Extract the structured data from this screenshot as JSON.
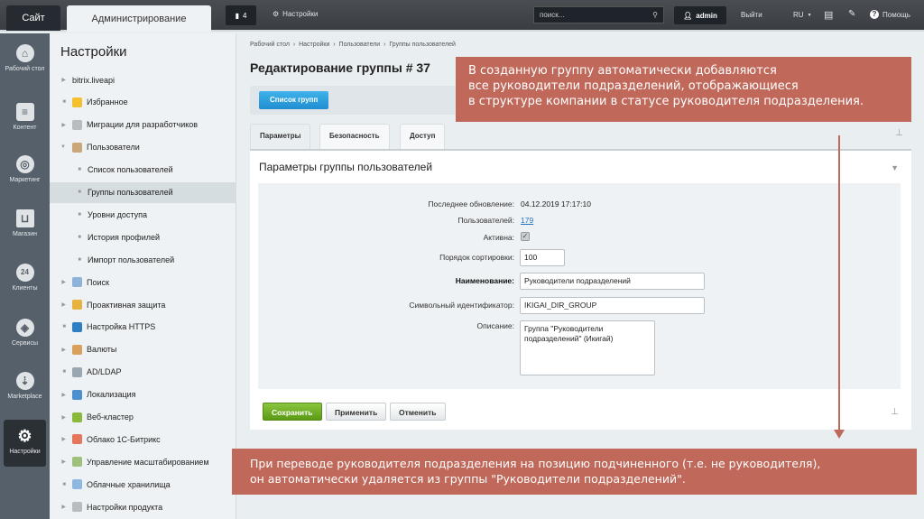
{
  "topbar": {
    "site": "Сайт",
    "admin": "Администрирование",
    "notifications": "4",
    "settings": "Настройки",
    "search_placeholder": "поиск...",
    "user": "admin",
    "logout": "Выйти",
    "lang": "RU",
    "help": "Помощь"
  },
  "iconbar": [
    {
      "label": "Рабочий стол",
      "icon": "home-icon"
    },
    {
      "label": "Контент",
      "icon": "document-icon"
    },
    {
      "label": "Маркетинг",
      "icon": "target-icon"
    },
    {
      "label": "Магазин",
      "icon": "basket-icon"
    },
    {
      "label": "Клиенты",
      "icon": "24-icon"
    },
    {
      "label": "Сервисы",
      "icon": "layers-icon"
    },
    {
      "label": "Marketplace",
      "icon": "cloud-download-icon"
    },
    {
      "label": "Настройки",
      "icon": "gear-icon"
    }
  ],
  "menu": {
    "title": "Настройки",
    "items": [
      {
        "label": "bitrix.liveapi"
      },
      {
        "label": "Избранное"
      },
      {
        "label": "Миграции для разработчиков"
      },
      {
        "label": "Пользователи"
      },
      {
        "label": "Список пользователей"
      },
      {
        "label": "Группы пользователей"
      },
      {
        "label": "Уровни доступа"
      },
      {
        "label": "История профилей"
      },
      {
        "label": "Импорт пользователей"
      },
      {
        "label": "Поиск"
      },
      {
        "label": "Проактивная защита"
      },
      {
        "label": "Настройка HTTPS"
      },
      {
        "label": "Валюты"
      },
      {
        "label": "AD/LDAP"
      },
      {
        "label": "Локализация"
      },
      {
        "label": "Веб-кластер"
      },
      {
        "label": "Облако 1С-Битрикс"
      },
      {
        "label": "Управление масштабированием"
      },
      {
        "label": "Облачные хранилища"
      },
      {
        "label": "Настройки продукта"
      }
    ]
  },
  "breadcrumbs": [
    "Рабочий стол",
    "Настройки",
    "Пользователи",
    "Группы пользователей"
  ],
  "page_title": "Редактирование группы # 37",
  "list_button": "Список групп",
  "tabs": [
    "Параметры",
    "Безопасность",
    "Доступ"
  ],
  "panel_title": "Параметры группы пользователей",
  "form": {
    "updated_label": "Последнее обновление:",
    "updated_value": "04.12.2019 17:17:10",
    "users_label": "Пользователей:",
    "users_value": "179",
    "active_label": "Активна:",
    "sort_label": "Порядок сортировки:",
    "sort_value": "100",
    "name_label": "Наименование:",
    "name_value": "Руководители подразделений",
    "code_label": "Символьный идентификатор:",
    "code_value": "IKIGAI_DIR_GROUP",
    "desc_label": "Описание:",
    "desc_value": "Группа \"Руководители подразделений\" (Икигай)"
  },
  "buttons": {
    "save": "Сохранить",
    "apply": "Применить",
    "cancel": "Отменить"
  },
  "callouts": {
    "top": [
      "В созданную группу автоматически добавляются",
      "все руководители подразделений, отображающиеся",
      "в структуре компании в статусе руководителя подразделения."
    ],
    "bottom": [
      "При переводе руководителя подразделения на позицию подчиненного (т.е. не руководителя),",
      "он автоматически удаляется из группы \"Руководители подразделений\"."
    ]
  },
  "colors": {
    "callout": "#c0685a",
    "accent": "#1f8dd1",
    "save": "#6aa518"
  }
}
